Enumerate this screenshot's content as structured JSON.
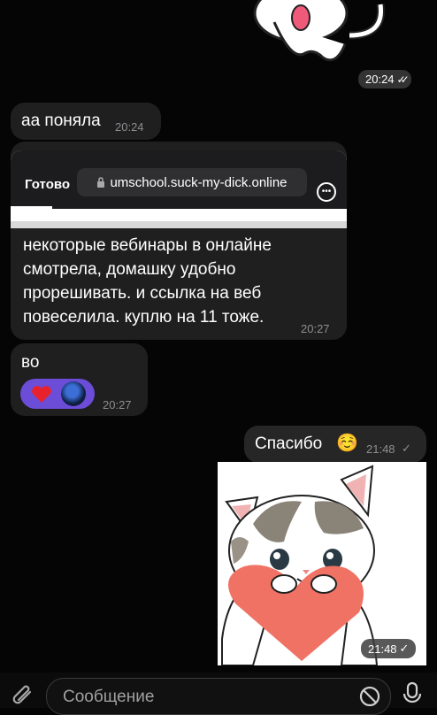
{
  "messages": {
    "sticker_top": {
      "time": "20:24",
      "status": "✓✓"
    },
    "m1": {
      "text": "аа поняла",
      "time": "20:24"
    },
    "m2": {
      "browser": {
        "done_label": "Готово",
        "url": "umschool.suck-my-dick.online"
      },
      "text_lines": [
        "некоторые вебинары в онлайне",
        "смотрела, домашку удобно",
        "прорешивать. и ссылка на веб",
        "повеселила. куплю на 11 тоже."
      ],
      "time": "20:27"
    },
    "m3": {
      "text": "во",
      "time": "20:27",
      "reactions": [
        "heart",
        "avatar"
      ]
    },
    "m4": {
      "text": "Спасибо",
      "emoji": "☺️",
      "time": "21:48",
      "status": "✓"
    },
    "sticker_bottom": {
      "time": "21:48",
      "status": "✓"
    }
  },
  "input": {
    "placeholder": "Сообщение"
  },
  "icons": [
    "attach-icon",
    "sticker-icon",
    "mic-icon",
    "lock-icon",
    "more-icon",
    "heart-icon"
  ],
  "colors": {
    "background": "#050505",
    "bubble": "#1f1f1f",
    "reaction": "#6c4dd8"
  }
}
